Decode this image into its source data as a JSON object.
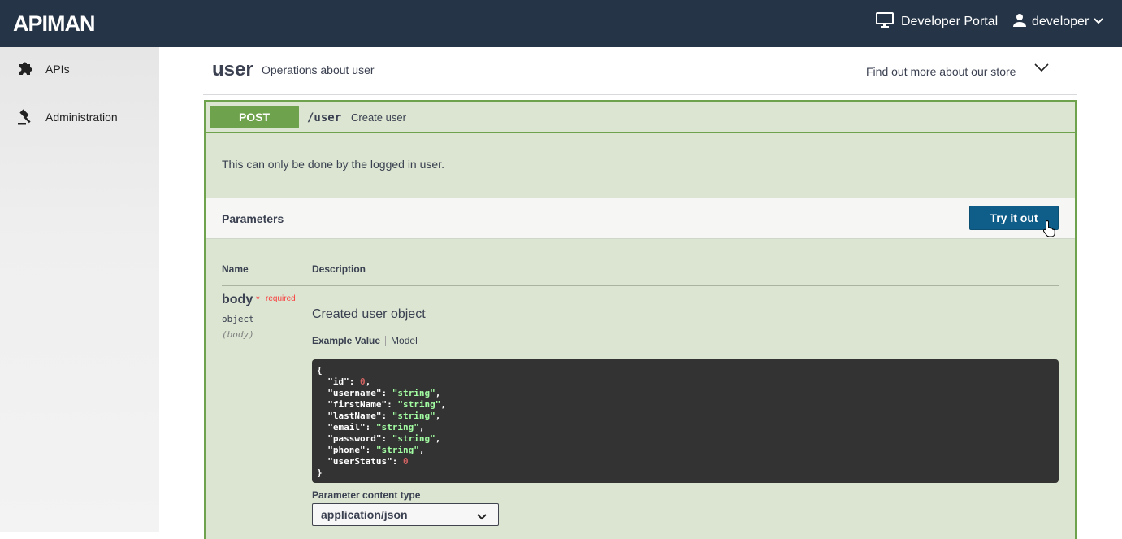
{
  "header": {
    "logo_text": "APIMAN",
    "portal_label": "Developer Portal",
    "portal_icon": "monitor-icon",
    "user_label": "developer",
    "user_icon": "person-icon",
    "bg_color": "#253447"
  },
  "sidebar": {
    "items": [
      {
        "label": "APIs",
        "icon": "puzzle-icon"
      },
      {
        "label": "Administration",
        "icon": "gavel-icon"
      }
    ]
  },
  "tag": {
    "name": "user",
    "description": "Operations about user",
    "external_link": "Find out more about our store"
  },
  "operation": {
    "method": "POST",
    "path": "/user",
    "summary": "Create user",
    "description": "This can only be done by the logged in user.",
    "method_color": "#6fa24c"
  },
  "parameters": {
    "title": "Parameters",
    "try_button": "Try it out",
    "columns": {
      "name": "Name",
      "description": "Description"
    },
    "items": [
      {
        "name": "body",
        "required_star": "*",
        "required_label": "required",
        "type": "object",
        "in": "(body)",
        "description": "Created user object",
        "example_tab": "Example Value",
        "model_tab": "Model",
        "example_lines": [
          "{",
          "  \"id\": 0,",
          "  \"username\": \"string\",",
          "  \"firstName\": \"string\",",
          "  \"lastName\": \"string\",",
          "  \"email\": \"string\",",
          "  \"password\": \"string\",",
          "  \"phone\": \"string\",",
          "  \"userStatus\": 0",
          "}"
        ]
      }
    ],
    "content_type_label": "Parameter content type",
    "content_type_value": "application/json"
  }
}
